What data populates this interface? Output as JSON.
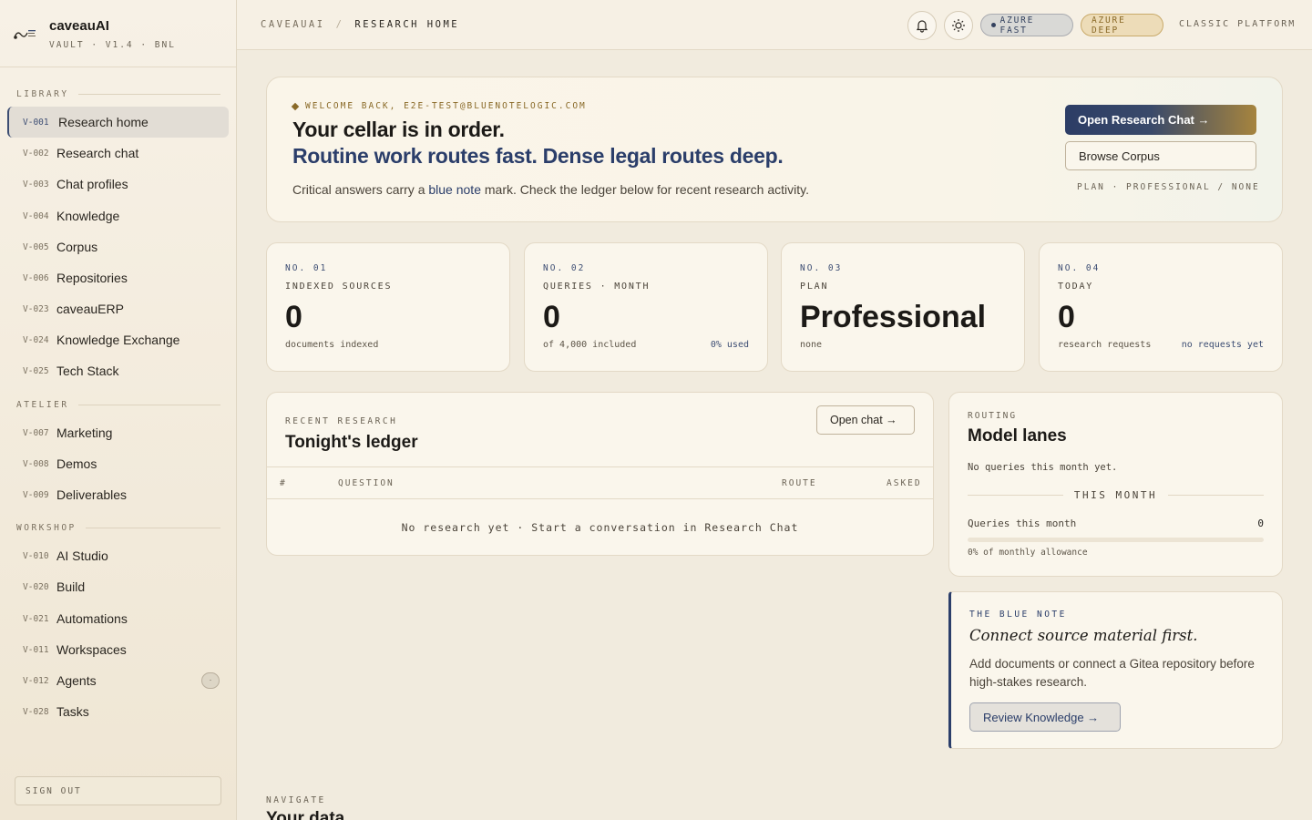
{
  "brand": {
    "name": "caveauAI",
    "version": "VAULT · V1.4 · BNL"
  },
  "sidebar": {
    "sections": [
      {
        "title": "LIBRARY"
      },
      {
        "title": "ATELIER"
      },
      {
        "title": "WORKSHOP"
      }
    ],
    "items": [
      {
        "code": "V-001",
        "label": "Research home"
      },
      {
        "code": "V-002",
        "label": "Research chat"
      },
      {
        "code": "V-003",
        "label": "Chat profiles"
      },
      {
        "code": "V-004",
        "label": "Knowledge"
      },
      {
        "code": "V-005",
        "label": "Corpus"
      },
      {
        "code": "V-006",
        "label": "Repositories"
      },
      {
        "code": "V-023",
        "label": "caveauERP"
      },
      {
        "code": "V-024",
        "label": "Knowledge Exchange"
      },
      {
        "code": "V-025",
        "label": "Tech Stack"
      },
      {
        "code": "V-007",
        "label": "Marketing"
      },
      {
        "code": "V-008",
        "label": "Demos"
      },
      {
        "code": "V-009",
        "label": "Deliverables"
      },
      {
        "code": "V-010",
        "label": "AI Studio"
      },
      {
        "code": "V-020",
        "label": "Build"
      },
      {
        "code": "V-021",
        "label": "Automations"
      },
      {
        "code": "V-011",
        "label": "Workspaces"
      },
      {
        "code": "V-012",
        "label": "Agents",
        "badge": "·"
      },
      {
        "code": "V-028",
        "label": "Tasks"
      }
    ],
    "signout": "SIGN OUT"
  },
  "header": {
    "crumb_root": "CAVEAUAI",
    "crumb_sep": "/",
    "crumb_current": "RESEARCH HOME",
    "pill_fast": "AZURE FAST",
    "pill_deep": "AZURE DEEP",
    "classic": "CLASSIC PLATFORM"
  },
  "hero": {
    "eyebrow": "WELCOME BACK, E2E-TEST@BLUENOTELOGIC.COM",
    "line1": "Your cellar is in order.",
    "line2": "Routine work routes fast. Dense legal routes deep.",
    "sub_pre": "Critical answers carry a ",
    "sub_em": "blue note",
    "sub_post": " mark. Check the ledger below for recent research activity.",
    "primary_btn": "Open Research Chat  →",
    "secondary_btn": "Browse Corpus",
    "plan": "PLAN · PROFESSIONAL / NONE"
  },
  "stats": [
    {
      "no": "NO. 01",
      "label": "INDEXED SOURCES",
      "value": "0",
      "foot": "documents indexed",
      "foot_right": ""
    },
    {
      "no": "NO. 02",
      "label": "QUERIES · MONTH",
      "value": "0",
      "foot": "of 4,000 included",
      "foot_right": "0% used"
    },
    {
      "no": "NO. 03",
      "label": "PLAN",
      "value": "Professional",
      "foot": "none",
      "foot_right": ""
    },
    {
      "no": "NO. 04",
      "label": "TODAY",
      "value": "0",
      "foot": "research requests",
      "foot_right": "no requests yet"
    }
  ],
  "ledger": {
    "kicker": "RECENT RESEARCH",
    "title": "Tonight's ledger",
    "open_btn": "Open chat  →",
    "columns": [
      "#",
      "QUESTION",
      "ROUTE",
      "ASKED"
    ],
    "empty": "No research yet · Start a conversation in Research Chat"
  },
  "routing": {
    "kicker": "ROUTING",
    "title": "Model lanes",
    "desc": "No queries this month yet.",
    "divider": "THIS MONTH",
    "row_label": "Queries this month",
    "row_value": "0",
    "allowance_fraction": 0,
    "caption": "0% of monthly allowance"
  },
  "bluenote": {
    "kicker": "THE BLUE NOTE",
    "title": "Connect source material first.",
    "body": "Add documents or connect a Gitea repository before high-stakes research.",
    "button": "Review Knowledge  →"
  },
  "navigate": {
    "kicker": "NAVIGATE",
    "title": "Your data"
  },
  "colors": {
    "accent_navy": "#2b3e6a",
    "accent_gold": "#a6843e",
    "background": "#f1ebde"
  },
  "icons": [
    "bell-icon",
    "sun-icon",
    "brand-logo-icon"
  ]
}
